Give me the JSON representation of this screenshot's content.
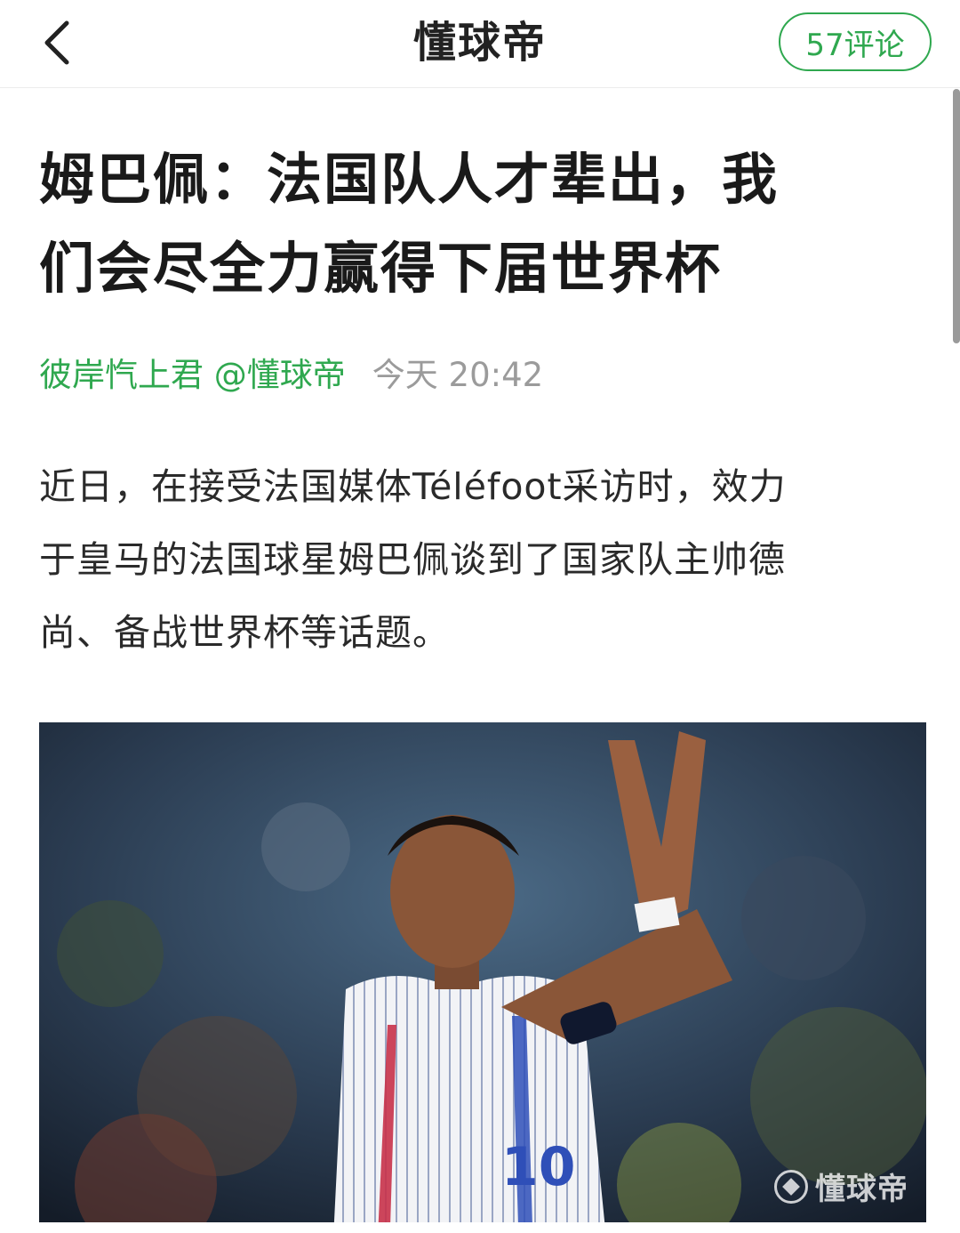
{
  "header": {
    "back_icon": "chevron-left-icon",
    "brand": "懂球帝",
    "comments_label": "57评论",
    "accent_color": "#2fa84f"
  },
  "article": {
    "title_line1": "姆巴佩：法国队人才辈出，我",
    "title_line2": "们会尽全力赢得下届世界杯",
    "author": "彼岸忾上君 @懂球帝",
    "time": "今天 20:42",
    "body_line1": "近日，在接受法国媒体Téléfoot采访时，效力",
    "body_line2": "于皇马的法国球星姆巴佩谈到了国家队主帅德",
    "body_line3": "尚、备战世界杯等话题。",
    "photo": {
      "description_icon": "photo-of-player-applauding",
      "watermark": "懂球帝",
      "jersey_number": "10"
    }
  }
}
